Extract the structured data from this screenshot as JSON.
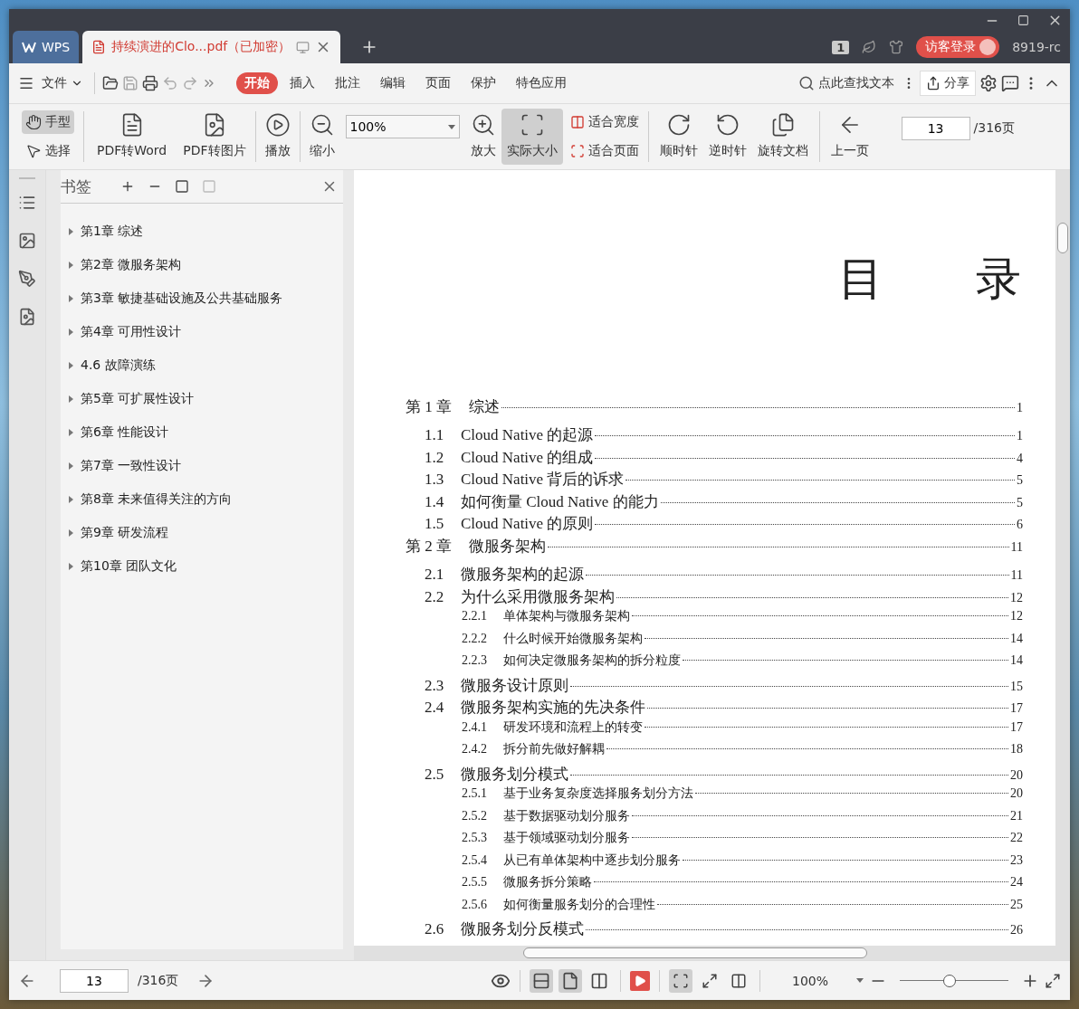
{
  "tabs": [
    {
      "label": "WPS",
      "kind": "home",
      "selected": false
    },
    {
      "label": "持续演进的Clo...pdf（已加密）",
      "kind": "document",
      "selected": true
    }
  ],
  "title_bar": {
    "page_badge": "1",
    "login": "访客登录",
    "user": "8919-rc"
  },
  "menu": {
    "file": "文件",
    "items": [
      {
        "label": "开始",
        "selected": true
      },
      {
        "label": "插入",
        "selected": false
      },
      {
        "label": "批注",
        "selected": false
      },
      {
        "label": "编辑",
        "selected": false
      },
      {
        "label": "页面",
        "selected": false
      },
      {
        "label": "保护",
        "selected": false
      },
      {
        "label": "特色应用",
        "selected": false
      }
    ],
    "search": "点此查找文本",
    "share": "分享"
  },
  "toolbar": {
    "modes": [
      {
        "label": "手型",
        "selected": true
      },
      {
        "label": "选择",
        "selected": false
      }
    ],
    "tools_left": [
      {
        "label": "PDF转Word",
        "selected": false
      },
      {
        "label": "PDF转图片",
        "selected": false
      },
      {
        "label": "播放",
        "selected": false
      },
      {
        "label": "缩小",
        "selected": false
      }
    ],
    "zoom": "100%",
    "tools_mid": [
      {
        "label": "放大",
        "selected": false
      },
      {
        "label": "实际大小",
        "selected": true
      }
    ],
    "fit": [
      {
        "label": "适合宽度"
      },
      {
        "label": "适合页面"
      }
    ],
    "tools_right": [
      {
        "label": "顺时针",
        "selected": false
      },
      {
        "label": "逆时针",
        "selected": false
      },
      {
        "label": "旋转文档",
        "selected": false
      },
      {
        "label": "上一页",
        "selected": false
      }
    ],
    "page": "13",
    "page_total": "/316页"
  },
  "bookmarks": {
    "title": "书签",
    "items": [
      {
        "label": "第1章 综述",
        "expanded": false
      },
      {
        "label": "第2章 微服务架构",
        "expanded": false
      },
      {
        "label": "第3章 敏捷基础设施及公共基础服务",
        "expanded": false
      },
      {
        "label": "第4章 可用性设计",
        "expanded": false
      },
      {
        "label": "4.6 故障演练",
        "expanded": false
      },
      {
        "label": "第5章 可扩展性设计",
        "expanded": false
      },
      {
        "label": "第6章 性能设计",
        "expanded": false
      },
      {
        "label": "第7章 一致性设计",
        "expanded": false
      },
      {
        "label": "第8章 未来值得关注的方向",
        "expanded": false
      },
      {
        "label": "第9章 研发流程",
        "expanded": false
      },
      {
        "label": "第10章 团队文化",
        "expanded": false
      }
    ]
  },
  "document": {
    "heading": "目录",
    "toc": [
      {
        "number": "第 1 章",
        "title": "综述",
        "page": "1",
        "children": [
          {
            "number": "1.1",
            "title": "Cloud Native 的起源",
            "page": "1"
          },
          {
            "number": "1.2",
            "title": "Cloud Native 的组成",
            "page": "4"
          },
          {
            "number": "1.3",
            "title": "Cloud Native 背后的诉求",
            "page": "5"
          },
          {
            "number": "1.4",
            "title": "如何衡量 Cloud Native 的能力",
            "page": "5"
          },
          {
            "number": "1.5",
            "title": "Cloud Native 的原则",
            "page": "6"
          }
        ]
      },
      {
        "number": "第 2 章",
        "title": "微服务架构",
        "page": "11",
        "children": [
          {
            "number": "2.1",
            "title": "微服务架构的起源",
            "page": "11"
          },
          {
            "number": "2.2",
            "title": "为什么采用微服务架构",
            "page": "12",
            "children": [
              {
                "number": "2.2.1",
                "title": "单体架构与微服务架构",
                "page": "12"
              },
              {
                "number": "2.2.2",
                "title": "什么时候开始微服务架构",
                "page": "14"
              },
              {
                "number": "2.2.3",
                "title": "如何决定微服务架构的拆分粒度",
                "page": "14"
              }
            ]
          },
          {
            "number": "2.3",
            "title": "微服务设计原则",
            "page": "15"
          },
          {
            "number": "2.4",
            "title": "微服务架构实施的先决条件",
            "page": "17",
            "children": [
              {
                "number": "2.4.1",
                "title": "研发环境和流程上的转变",
                "page": "17"
              },
              {
                "number": "2.4.2",
                "title": "拆分前先做好解耦",
                "page": "18"
              }
            ]
          },
          {
            "number": "2.5",
            "title": "微服务划分模式",
            "page": "20",
            "children": [
              {
                "number": "2.5.1",
                "title": "基于业务复杂度选择服务划分方法",
                "page": "20"
              },
              {
                "number": "2.5.2",
                "title": "基于数据驱动划分服务",
                "page": "21"
              },
              {
                "number": "2.5.3",
                "title": "基于领域驱动划分服务",
                "page": "22"
              },
              {
                "number": "2.5.4",
                "title": "从已有单体架构中逐步划分服务",
                "page": "23"
              },
              {
                "number": "2.5.5",
                "title": "微服务拆分策略",
                "page": "24"
              },
              {
                "number": "2.5.6",
                "title": "如何衡量服务划分的合理性",
                "page": "25"
              }
            ]
          },
          {
            "number": "2.6",
            "title": "微服务划分反模式",
            "page": "26"
          }
        ]
      }
    ]
  },
  "status_bar": {
    "page": "13",
    "page_total": "/316页",
    "layout_buttons": [
      {
        "selected": true
      },
      {
        "selected": true
      },
      {
        "selected": false
      }
    ],
    "fit_buttons": [
      {
        "selected": true
      },
      {
        "selected": false
      },
      {
        "selected": false
      }
    ],
    "zoom": "100%",
    "zoom_slider": {
      "level": 0.46
    }
  }
}
